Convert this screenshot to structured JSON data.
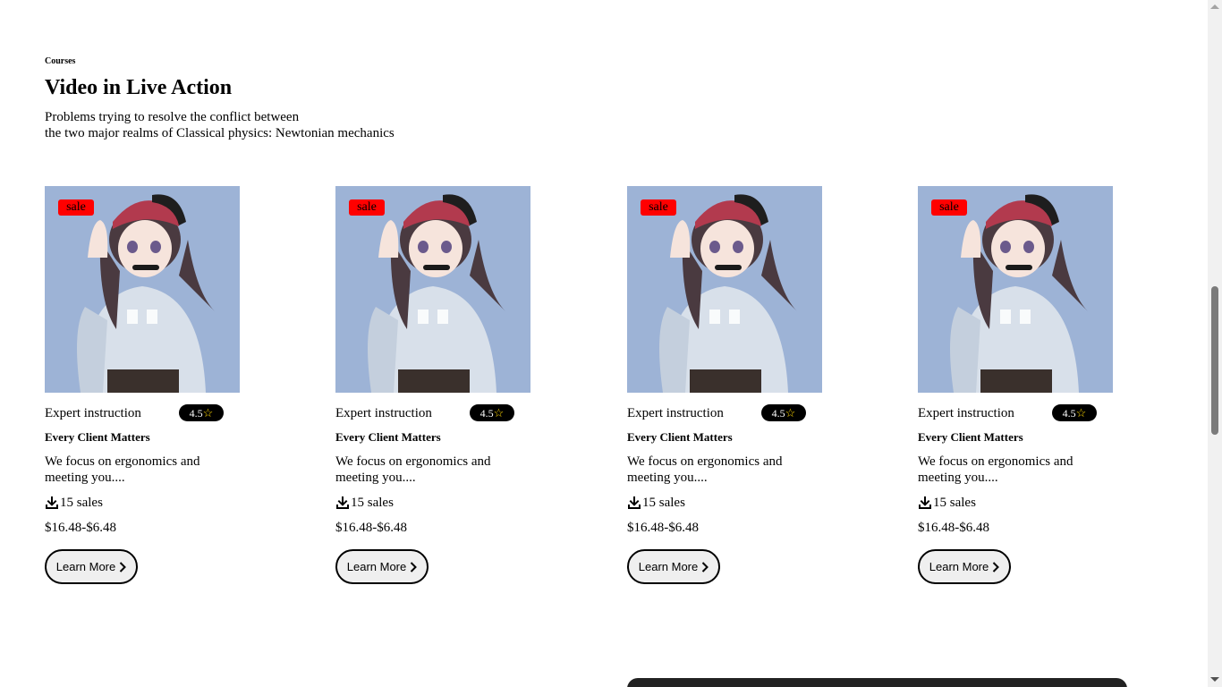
{
  "section": {
    "eyebrow": "Courses",
    "title": "Video in Live Action",
    "description_line1": "Problems trying to resolve the conflict between",
    "description_line2": "the two major realms of Classical physics: Newtonian mechanics"
  },
  "cards": [
    {
      "badge": "sale",
      "instruction": "Expert instruction",
      "rating": "4.5",
      "title": "Every Client Matters",
      "text_line1": "We focus on ergonomics and",
      "text_line2": "meeting you....",
      "sales": "15 sales",
      "price": "$16.48-$6.48",
      "button": "Learn More"
    },
    {
      "badge": "sale",
      "instruction": "Expert instruction",
      "rating": "4.5",
      "title": "Every Client Matters",
      "text_line1": "We focus on ergonomics and",
      "text_line2": "meeting you....",
      "sales": "15 sales",
      "price": "$16.48-$6.48",
      "button": "Learn More"
    },
    {
      "badge": "sale",
      "instruction": "Expert instruction",
      "rating": "4.5",
      "title": "Every Client Matters",
      "text_line1": "We focus on ergonomics and",
      "text_line2": "meeting you....",
      "sales": "15 sales",
      "price": "$16.48-$6.48",
      "button": "Learn More"
    },
    {
      "badge": "sale",
      "instruction": "Expert instruction",
      "rating": "4.5",
      "title": "Every Client Matters",
      "text_line1": "We focus on ergonomics and",
      "text_line2": "meeting you....",
      "sales": "15 sales",
      "price": "$16.48-$6.48",
      "button": "Learn More"
    }
  ],
  "icons": {
    "rating": "star-outline-icon",
    "sales": "download-icon",
    "button": "chevron-right-icon"
  },
  "colors": {
    "sale_badge": "#ff0000",
    "rating_pill": "#000000",
    "star": "#ffd700",
    "thumbnail_background": "#9db3d6"
  }
}
